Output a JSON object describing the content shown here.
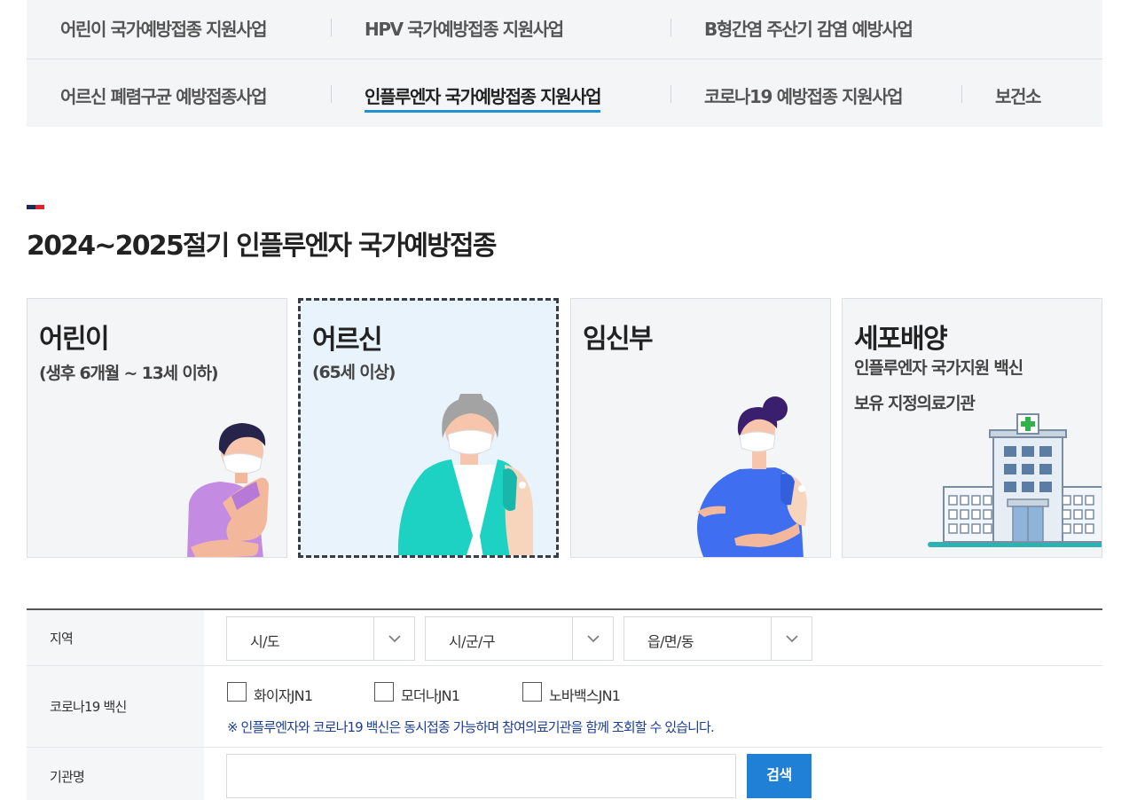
{
  "nav": {
    "row1": [
      {
        "label": "어린이 국가예방접종 지원사업"
      },
      {
        "label": "HPV 국가예방접종 지원사업"
      },
      {
        "label": "B형간염 주산기 감염 예방사업"
      }
    ],
    "row2": [
      {
        "label": "어르신 폐렴구균 예방접종사업"
      },
      {
        "label": "인플루엔자 국가예방접종 지원사업",
        "active": true
      },
      {
        "label": "코로나19 예방접종 지원사업"
      },
      {
        "label": "보건소"
      }
    ]
  },
  "section": {
    "title": "2024~2025절기 인플루엔자 국가예방접종"
  },
  "cards": [
    {
      "title": "어린이",
      "subtitle": "(생후 6개월 ~ 13세 이하)",
      "icon": "child-vaccination-illustration"
    },
    {
      "title": "어르신",
      "subtitle": "(65세 이상)",
      "icon": "senior-vaccination-illustration",
      "selected": true
    },
    {
      "title": "임신부",
      "subtitle": "",
      "icon": "pregnant-woman-illustration"
    },
    {
      "title": "세포배양",
      "subtitle_line1": "인플루엔자 국가지원 백신",
      "subtitle_line2": "보유 지정의료기관",
      "icon": "hospital-building-illustration"
    }
  ],
  "form": {
    "region": {
      "label": "지역",
      "selects": [
        {
          "value": "시/도"
        },
        {
          "value": "시/군/구"
        },
        {
          "value": "읍/면/동"
        }
      ]
    },
    "covid": {
      "label": "코로나19 백신",
      "options": [
        {
          "label": "화이자JN1",
          "checked": false
        },
        {
          "label": "모더나JN1",
          "checked": false
        },
        {
          "label": "노바백스JN1",
          "checked": false
        }
      ],
      "note": "※ 인플루엔자와 코로나19 백신은 동시접종 가능하며 참여의료기관을 함께 조회할 수 있습니다."
    },
    "institution": {
      "label": "기관명",
      "value": "",
      "placeholder": "",
      "search_button": "검색"
    }
  },
  "colors": {
    "accent": "#1f80d6",
    "active_underline": "#1f90d4",
    "note_text": "#1d3e95",
    "selected_card_bg": "#e8f3fc"
  }
}
